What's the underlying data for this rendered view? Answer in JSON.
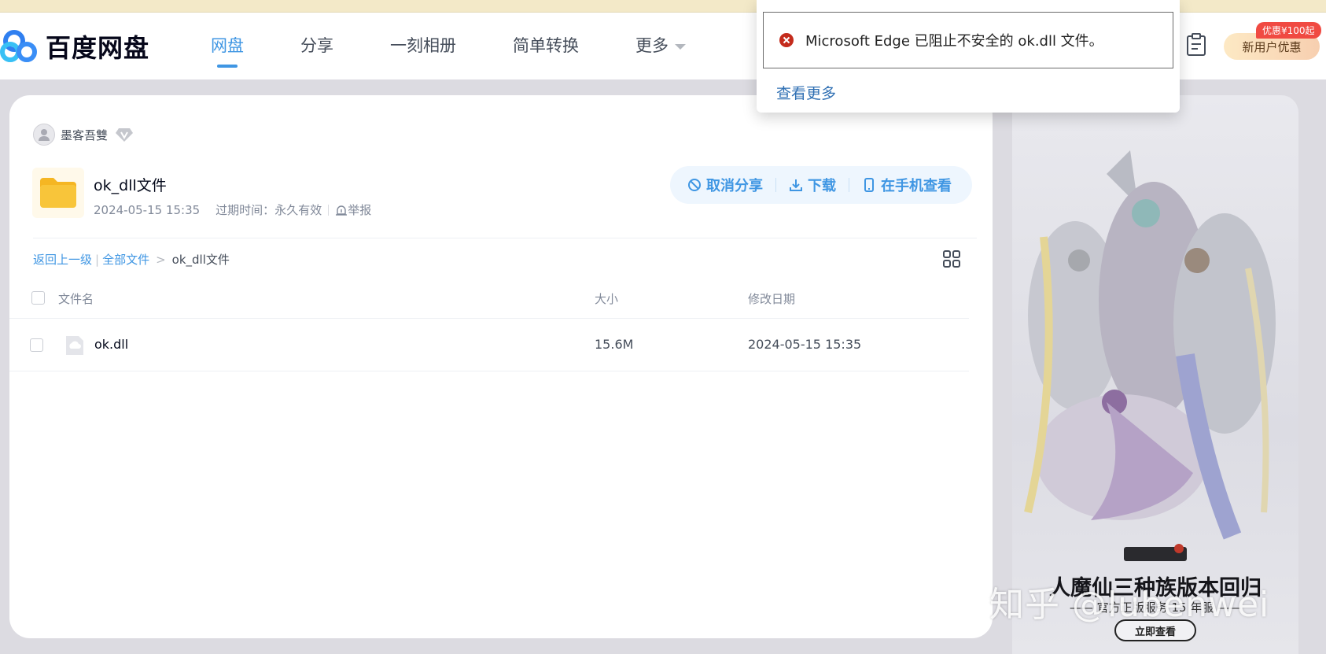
{
  "header": {
    "logo_text": "百度网盘",
    "nav": [
      {
        "label": "网盘",
        "active": true
      },
      {
        "label": "分享",
        "active": false
      },
      {
        "label": "一刻相册",
        "active": false
      },
      {
        "label": "简单转换",
        "active": false
      },
      {
        "label": "更多",
        "active": false
      }
    ],
    "promo_label": "新用户优惠",
    "promo_badge": "优惠¥100起"
  },
  "share": {
    "owner_name": "墨客吾雙",
    "folder_name": "ok_dll文件",
    "created": "2024-05-15 15:35",
    "expiry_label": "过期时间：",
    "expiry_value": "永久有效",
    "report_label": "举报",
    "actions": {
      "cancel_share": "取消分享",
      "download": "下载",
      "view_on_phone": "在手机查看"
    }
  },
  "breadcrumb": {
    "back": "返回上一级",
    "all_files": "全部文件",
    "current": "ok_dll文件"
  },
  "table": {
    "columns": {
      "name": "文件名",
      "size": "大小",
      "date": "修改日期"
    },
    "rows": [
      {
        "name": "ok.dll",
        "size": "15.6M",
        "date": "2024-05-15 15:35"
      }
    ]
  },
  "ad": {
    "headline": "人魔仙三种族版本回归",
    "subline": "—— 官方正版服务 15 年服 ——",
    "cta": "立即查看"
  },
  "watermark": "知乎 @lubenwei",
  "edge_toast": {
    "message": "Microsoft Edge 已阻止不安全的 ok.dll 文件。",
    "more_link": "查看更多"
  },
  "colors": {
    "accent": "#3f96e3",
    "error": "#c42b1c",
    "folder": "#f8c53a"
  }
}
